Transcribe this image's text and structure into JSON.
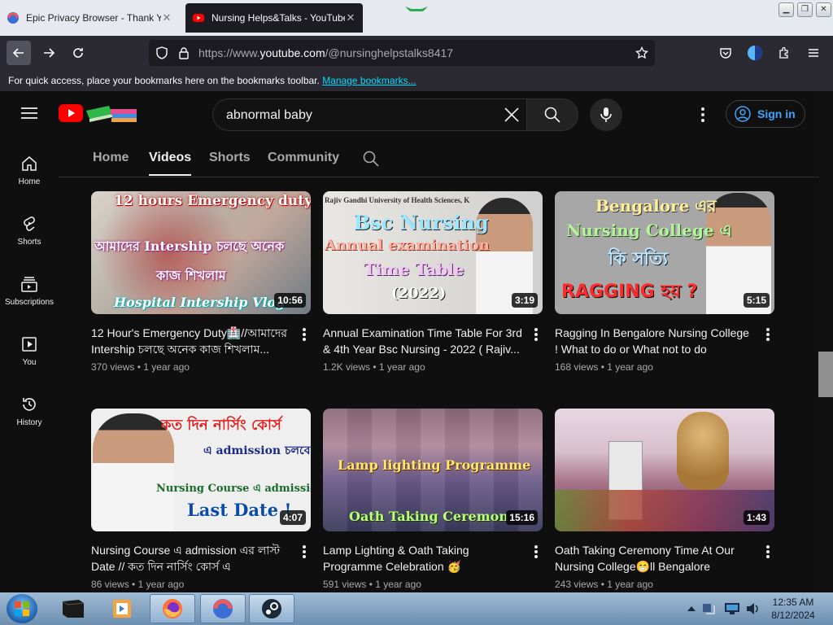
{
  "browser": {
    "tabs": [
      {
        "title": "Epic Privacy Browser - Thank Yo",
        "active": false
      },
      {
        "title": "Nursing Helps&Talks - YouTube",
        "active": true
      }
    ],
    "url_prefix": "https://www.",
    "url_host": "youtube.com",
    "url_path": "/@nursinghelpstalks8417",
    "bookmarks_text": "For quick access, place your bookmarks here on the bookmarks toolbar.",
    "bookmarks_link": "Manage bookmarks..."
  },
  "youtube": {
    "search_query": "abnormal baby",
    "sign_in": "Sign in",
    "sidebar": [
      {
        "label": "Home",
        "icon": "home-icon"
      },
      {
        "label": "Shorts",
        "icon": "shorts-icon"
      },
      {
        "label": "Subscriptions",
        "icon": "subscriptions-icon"
      },
      {
        "label": "You",
        "icon": "you-icon"
      },
      {
        "label": "History",
        "icon": "history-icon"
      }
    ],
    "channel_tabs": [
      "Home",
      "Videos",
      "Shorts",
      "Community"
    ],
    "selected_tab": "Videos",
    "videos": [
      {
        "title": "12 Hour's Emergency Duty🏥//আমাদের Intership চলছে অনেক কাজ শিখলাম...",
        "views": "370 views",
        "age": "1 year ago",
        "duration": "10:56",
        "thumb_text": [
          "12 hours Emergency duty",
          "আমাদের Intership চলছে অনেক",
          "কাজ শিখলাম",
          "Hospital Intership Vlog"
        ]
      },
      {
        "title": "Annual Examination Time Table For 3rd & 4th Year Bsc Nursing - 2022 ( Rajiv...",
        "views": "1.2K views",
        "age": "1 year ago",
        "duration": "3:19",
        "thumb_text": [
          "Bsc Nursing",
          "Annual examination",
          "Time Table",
          "(2022)",
          "Rajiv Gandhi University of Health Sciences, K"
        ]
      },
      {
        "title": "Ragging In Bengalore Nursing College ! What to do or What not to do",
        "views": "168 views",
        "age": "1 year ago",
        "duration": "5:15",
        "thumb_text": [
          "Bengalore এর",
          "Nursing College এ",
          "কি সত্যি",
          "RAGGING হয় ?"
        ]
      },
      {
        "title": "Nursing Course এ admission এর লাস্ট Date // কত দিন নার্সিং কোর্স এ admission...",
        "views": "86 views",
        "age": "1 year ago",
        "duration": "4:07",
        "thumb_text": [
          "কত দিন নার্সিং কোর্স",
          "এ admission চলবে",
          "Nursing Course এ admission",
          "Last Date !"
        ]
      },
      {
        "title": "Lamp Lighting & Oath Taking Programme Celebration 🥳",
        "views": "591 views",
        "age": "1 year ago",
        "duration": "15:16",
        "thumb_text": [
          "Lamp lighting Programme",
          "Oath Taking Ceremon"
        ]
      },
      {
        "title": "Oath Taking Ceremony Time At Our Nursing College😁ll Bengalore",
        "views": "243 views",
        "age": "1 year ago",
        "duration": "1:43",
        "thumb_text": []
      }
    ]
  },
  "taskbar": {
    "time": "12:35 AM",
    "date": "8/12/2024"
  },
  "colors": {
    "youtube_red": "#ff0000",
    "link_blue": "#3ea6ff",
    "page_bg": "#0f0f0f",
    "browser_toolbar": "#2b2a33"
  }
}
